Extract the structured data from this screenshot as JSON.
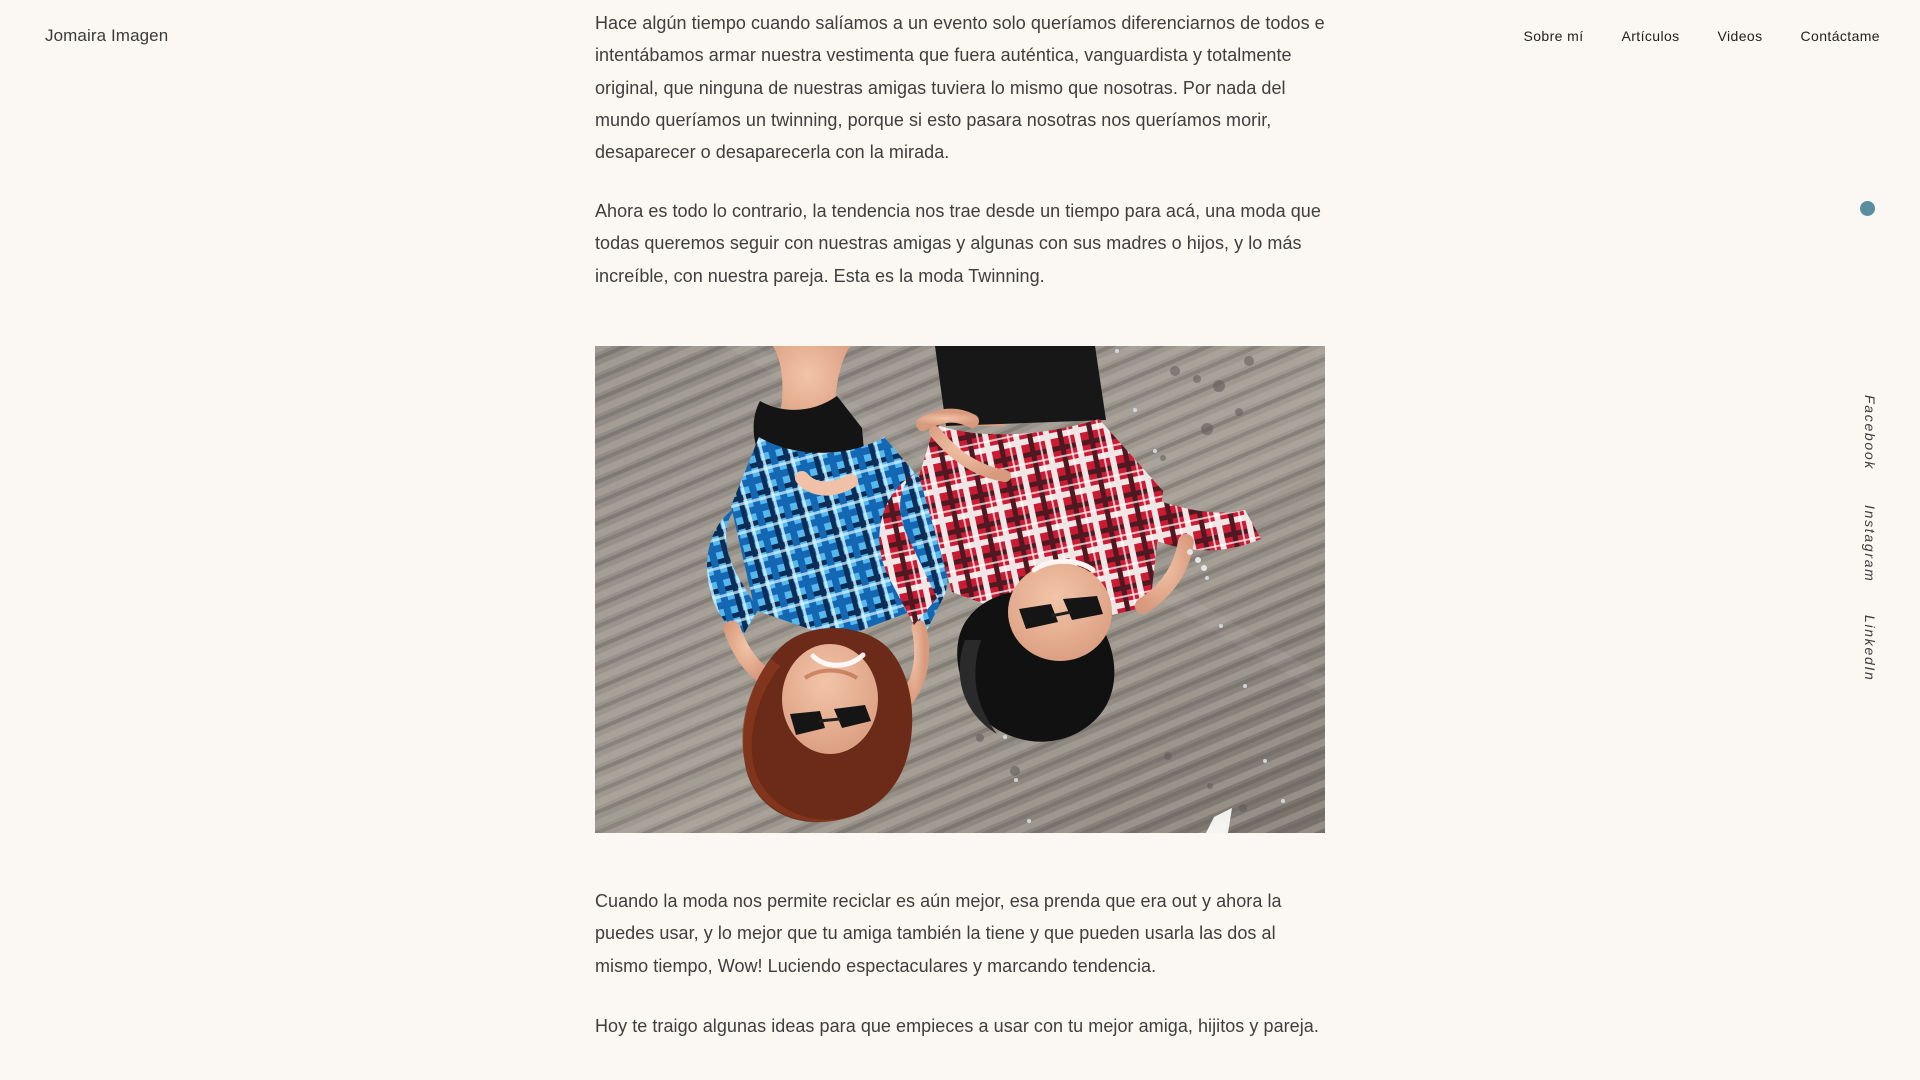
{
  "header": {
    "brand": "Jomaira Imagen",
    "nav": [
      "Sobre mí",
      "Artículos",
      "Videos",
      "Contáctame"
    ]
  },
  "article": {
    "paragraphs": [
      "Hace algún tiempo cuando salíamos a un evento solo queríamos diferenciarnos de todos e intentábamos armar nuestra vestimenta que fuera auténtica, vanguardista y totalmente original, que ninguna de nuestras amigas tuviera lo mismo que nosotras. Por nada del mundo queríamos un twinning, porque si esto pasara nosotras nos queríamos morir, desaparecer o desaparecerla con la mirada.",
      "Ahora es todo lo contrario, la tendencia nos trae desde un tiempo para acá, una moda que todas queremos seguir con nuestras amigas y algunas con sus madres o hijos, y lo más increíble, con nuestra pareja. Esta es la moda Twinning.",
      "Cuando la moda nos permite reciclar es aún mejor, esa prenda que era out y ahora la puedes usar, y lo mejor que tu amiga también la tiene y que pueden usarla las dos al mismo tiempo, Wow! Luciendo espectaculares y marcando tendencia.",
      "Hoy te traigo algunas ideas para que empieces a usar con tu mejor amiga, hijitos y pareja."
    ]
  },
  "side": {
    "social": [
      "Facebook",
      "Instagram",
      "LinkedIn"
    ],
    "accent_color": "#5b8da0"
  },
  "image": {
    "icon": "two-women-lying-on-wooden-deck-photo"
  }
}
